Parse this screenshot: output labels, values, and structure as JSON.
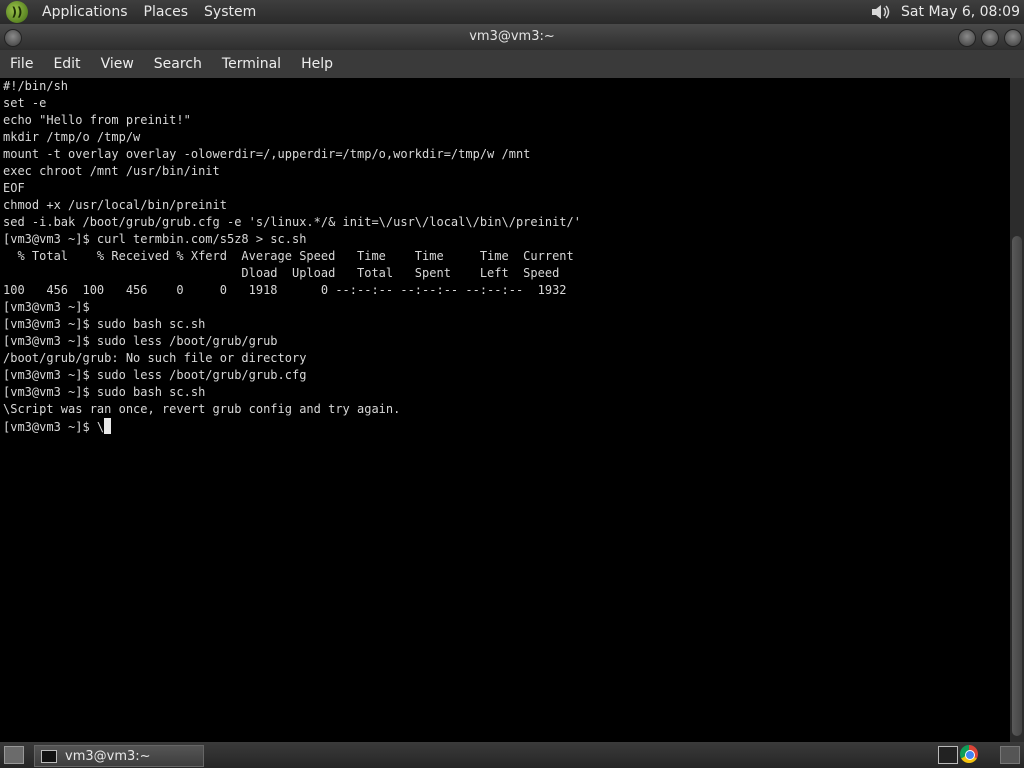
{
  "top_panel": {
    "menus": [
      "Applications",
      "Places",
      "System"
    ],
    "clock": "Sat May  6, 08:09"
  },
  "window": {
    "title": "vm3@vm3:~"
  },
  "menubar": {
    "items": [
      "File",
      "Edit",
      "View",
      "Search",
      "Terminal",
      "Help"
    ]
  },
  "terminal": {
    "lines": [
      "#!/bin/sh",
      "set -e",
      "echo \"Hello from preinit!\"",
      "mkdir /tmp/o /tmp/w",
      "mount -t overlay overlay -olowerdir=/,upperdir=/tmp/o,workdir=/tmp/w /mnt",
      "exec chroot /mnt /usr/bin/init",
      "EOF",
      "chmod +x /usr/local/bin/preinit",
      "sed -i.bak /boot/grub/grub.cfg -e 's/linux.*/& init=\\/usr\\/local\\/bin\\/preinit/'",
      "[vm3@vm3 ~]$ curl termbin.com/s5z8 > sc.sh",
      "  % Total    % Received % Xferd  Average Speed   Time    Time     Time  Current",
      "                                 Dload  Upload   Total   Spent    Left  Speed",
      "100   456  100   456    0     0   1918      0 --:--:-- --:--:-- --:--:--  1932",
      "[vm3@vm3 ~]$",
      "[vm3@vm3 ~]$ sudo bash sc.sh",
      "[vm3@vm3 ~]$ sudo less /boot/grub/grub",
      "/boot/grub/grub: No such file or directory",
      "[vm3@vm3 ~]$ sudo less /boot/grub/grub.cfg",
      "[vm3@vm3 ~]$ sudo bash sc.sh",
      "\\Script was ran once, revert grub config and try again."
    ],
    "prompt_line": "[vm3@vm3 ~]$ \\"
  },
  "taskbar": {
    "task_label": "vm3@vm3:~"
  },
  "icons": {
    "logo": "distro-logo-icon",
    "volume": "speaker-icon",
    "terminal": "terminal-icon",
    "browser": "chrome-icon"
  }
}
